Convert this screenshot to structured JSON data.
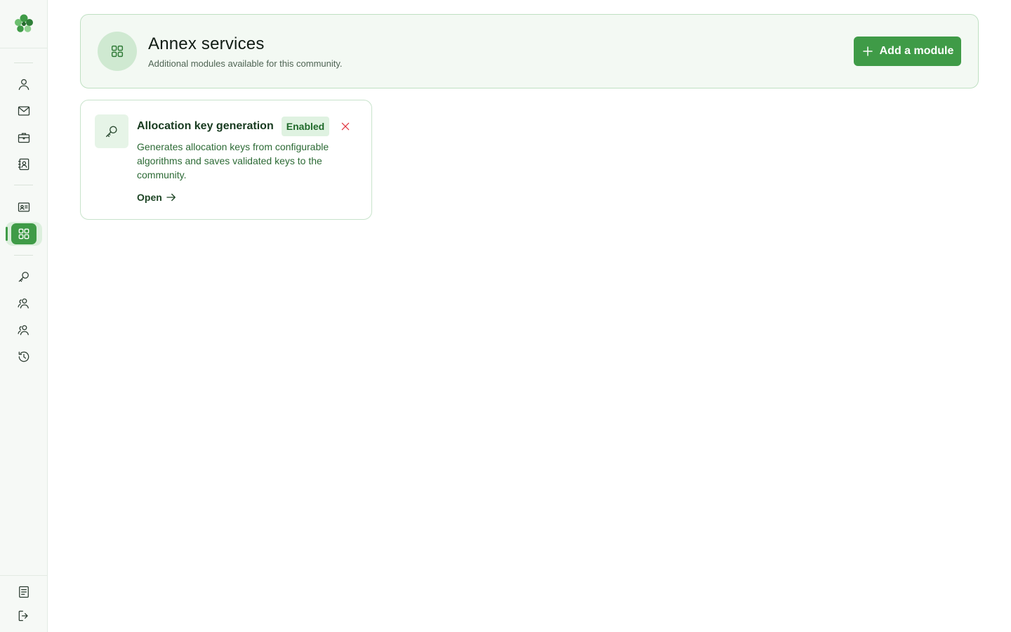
{
  "sidebar": {
    "logo_icon": "clover-logo",
    "items": [
      {
        "icon": "user-icon",
        "name": "nav-user"
      },
      {
        "icon": "mail-icon",
        "name": "nav-mail"
      },
      {
        "icon": "briefcase-icon",
        "name": "nav-briefcase"
      },
      {
        "icon": "contact-book-icon",
        "name": "nav-contacts"
      },
      {
        "icon": "id-card-icon",
        "name": "nav-id-card"
      },
      {
        "icon": "grid-icon",
        "name": "nav-annex-services",
        "active": true
      },
      {
        "icon": "key-icon",
        "name": "nav-keys"
      },
      {
        "icon": "users-icon",
        "name": "nav-users-1"
      },
      {
        "icon": "users-icon",
        "name": "nav-users-2"
      },
      {
        "icon": "history-icon",
        "name": "nav-history"
      }
    ],
    "footer_items": [
      {
        "icon": "document-icon",
        "name": "nav-docs"
      },
      {
        "icon": "logout-icon",
        "name": "nav-logout"
      }
    ]
  },
  "header": {
    "icon": "grid-icon",
    "title": "Annex services",
    "subtitle": "Additional modules available for this community.",
    "add_button_label": "Add a module",
    "add_button_icon": "plus-icon"
  },
  "modules": [
    {
      "icon": "key-icon",
      "title": "Allocation key generation",
      "status": "Enabled",
      "description": "Generates allocation keys from configurable algorithms and saves validated keys to the community.",
      "open_label": "Open",
      "remove_icon": "close-icon"
    }
  ],
  "colors": {
    "accent": "#3f9b47",
    "accent_light": "#dff2e1",
    "danger": "#e0343f",
    "sidebar_bg": "#f6f9f6"
  }
}
